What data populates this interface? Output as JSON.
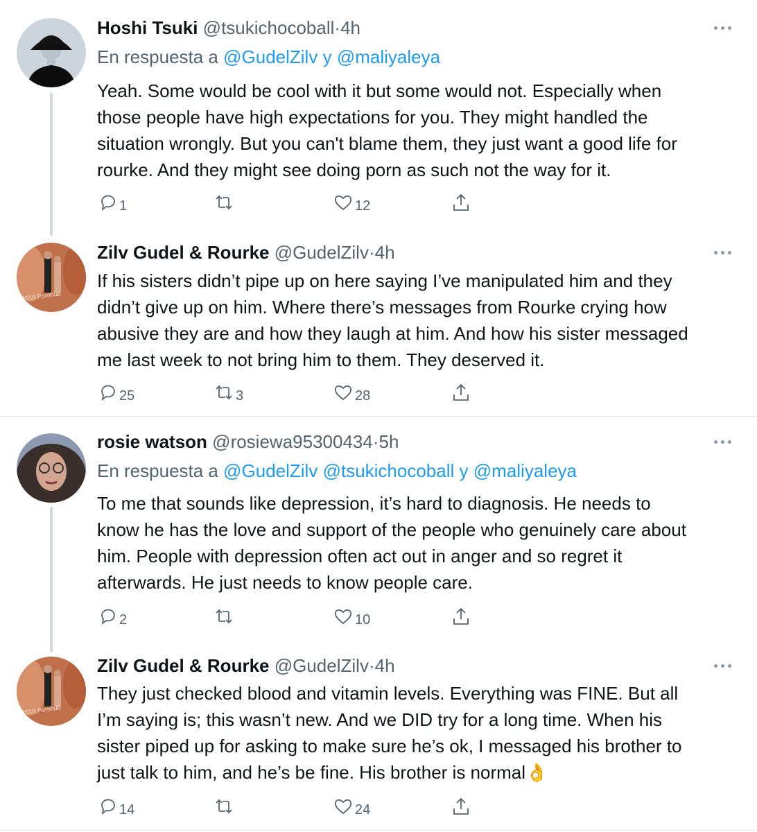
{
  "tweets": [
    {
      "name": "Hoshi Tsuki",
      "handle": "@tsukichocoball",
      "separator": "·",
      "time": "4h",
      "reply_prefix": "En respuesta a",
      "reply_mentions": [
        "@GudelZilv",
        "@maliyaleya"
      ],
      "reply_joiner": "y",
      "text": "Yeah. Some would be cool with it but some would not. Especially when\nthose people have high expectations for you. They might handled the\nsituation wrongly. But you can't blame them, they just want a good life for\nrourke. And they might see doing porn as such not the way for it.",
      "replies": "1",
      "retweets": "",
      "likes": "12"
    },
    {
      "name": "Zilv Gudel & Rourke",
      "handle": "@GudelZilv",
      "separator": "·",
      "time": "4h",
      "text": "If his sisters didn’t pipe up on here saying I’ve manipulated him and they\ndidn’t give up on him. Where there’s messages from Rourke crying how\nabusive they are and how they laugh at him. And how his sister messaged\nme last week to not bring him to them. They deserved it.",
      "replies": "25",
      "retweets": "3",
      "likes": "28"
    },
    {
      "name": "rosie watson",
      "handle": "@rosiewa95300434",
      "separator": "·",
      "time": "5h",
      "reply_prefix": "En respuesta a",
      "reply_mentions": [
        "@GudelZilv",
        "@tsukichocoball",
        "@maliyaleya"
      ],
      "reply_joiner": "y",
      "text": "To me that sounds like depression, it’s hard to diagnosis. He needs to\nknow he has the love and support of the people who genuinely care about\nhim. People with depression often act out in anger and so regret it\nafterwards. He just needs to know people care.",
      "replies": "2",
      "retweets": "",
      "likes": "10"
    },
    {
      "name": "Zilv Gudel & Rourke",
      "handle": "@GudelZilv",
      "separator": "·",
      "time": "4h",
      "text": "They just checked blood and vitamin levels. Everything was FINE. But all\nI’m saying is; this wasn’t new. And we DID try for a long time. When his\nsister piped up for asking to make sure he’s ok, I messaged his brother to\njust talk to him, and he’s be fine. His brother is normal",
      "emoji": "👌",
      "replies": "14",
      "retweets": "",
      "likes": "24"
    }
  ],
  "colors": {
    "link": "#1d9bf0",
    "secondary_text": "#536471",
    "thread_line": "#cfd9de",
    "divider": "#e7ebee"
  },
  "icons": [
    "reply-icon",
    "retweet-icon",
    "like-icon",
    "share-icon",
    "more-icon"
  ]
}
